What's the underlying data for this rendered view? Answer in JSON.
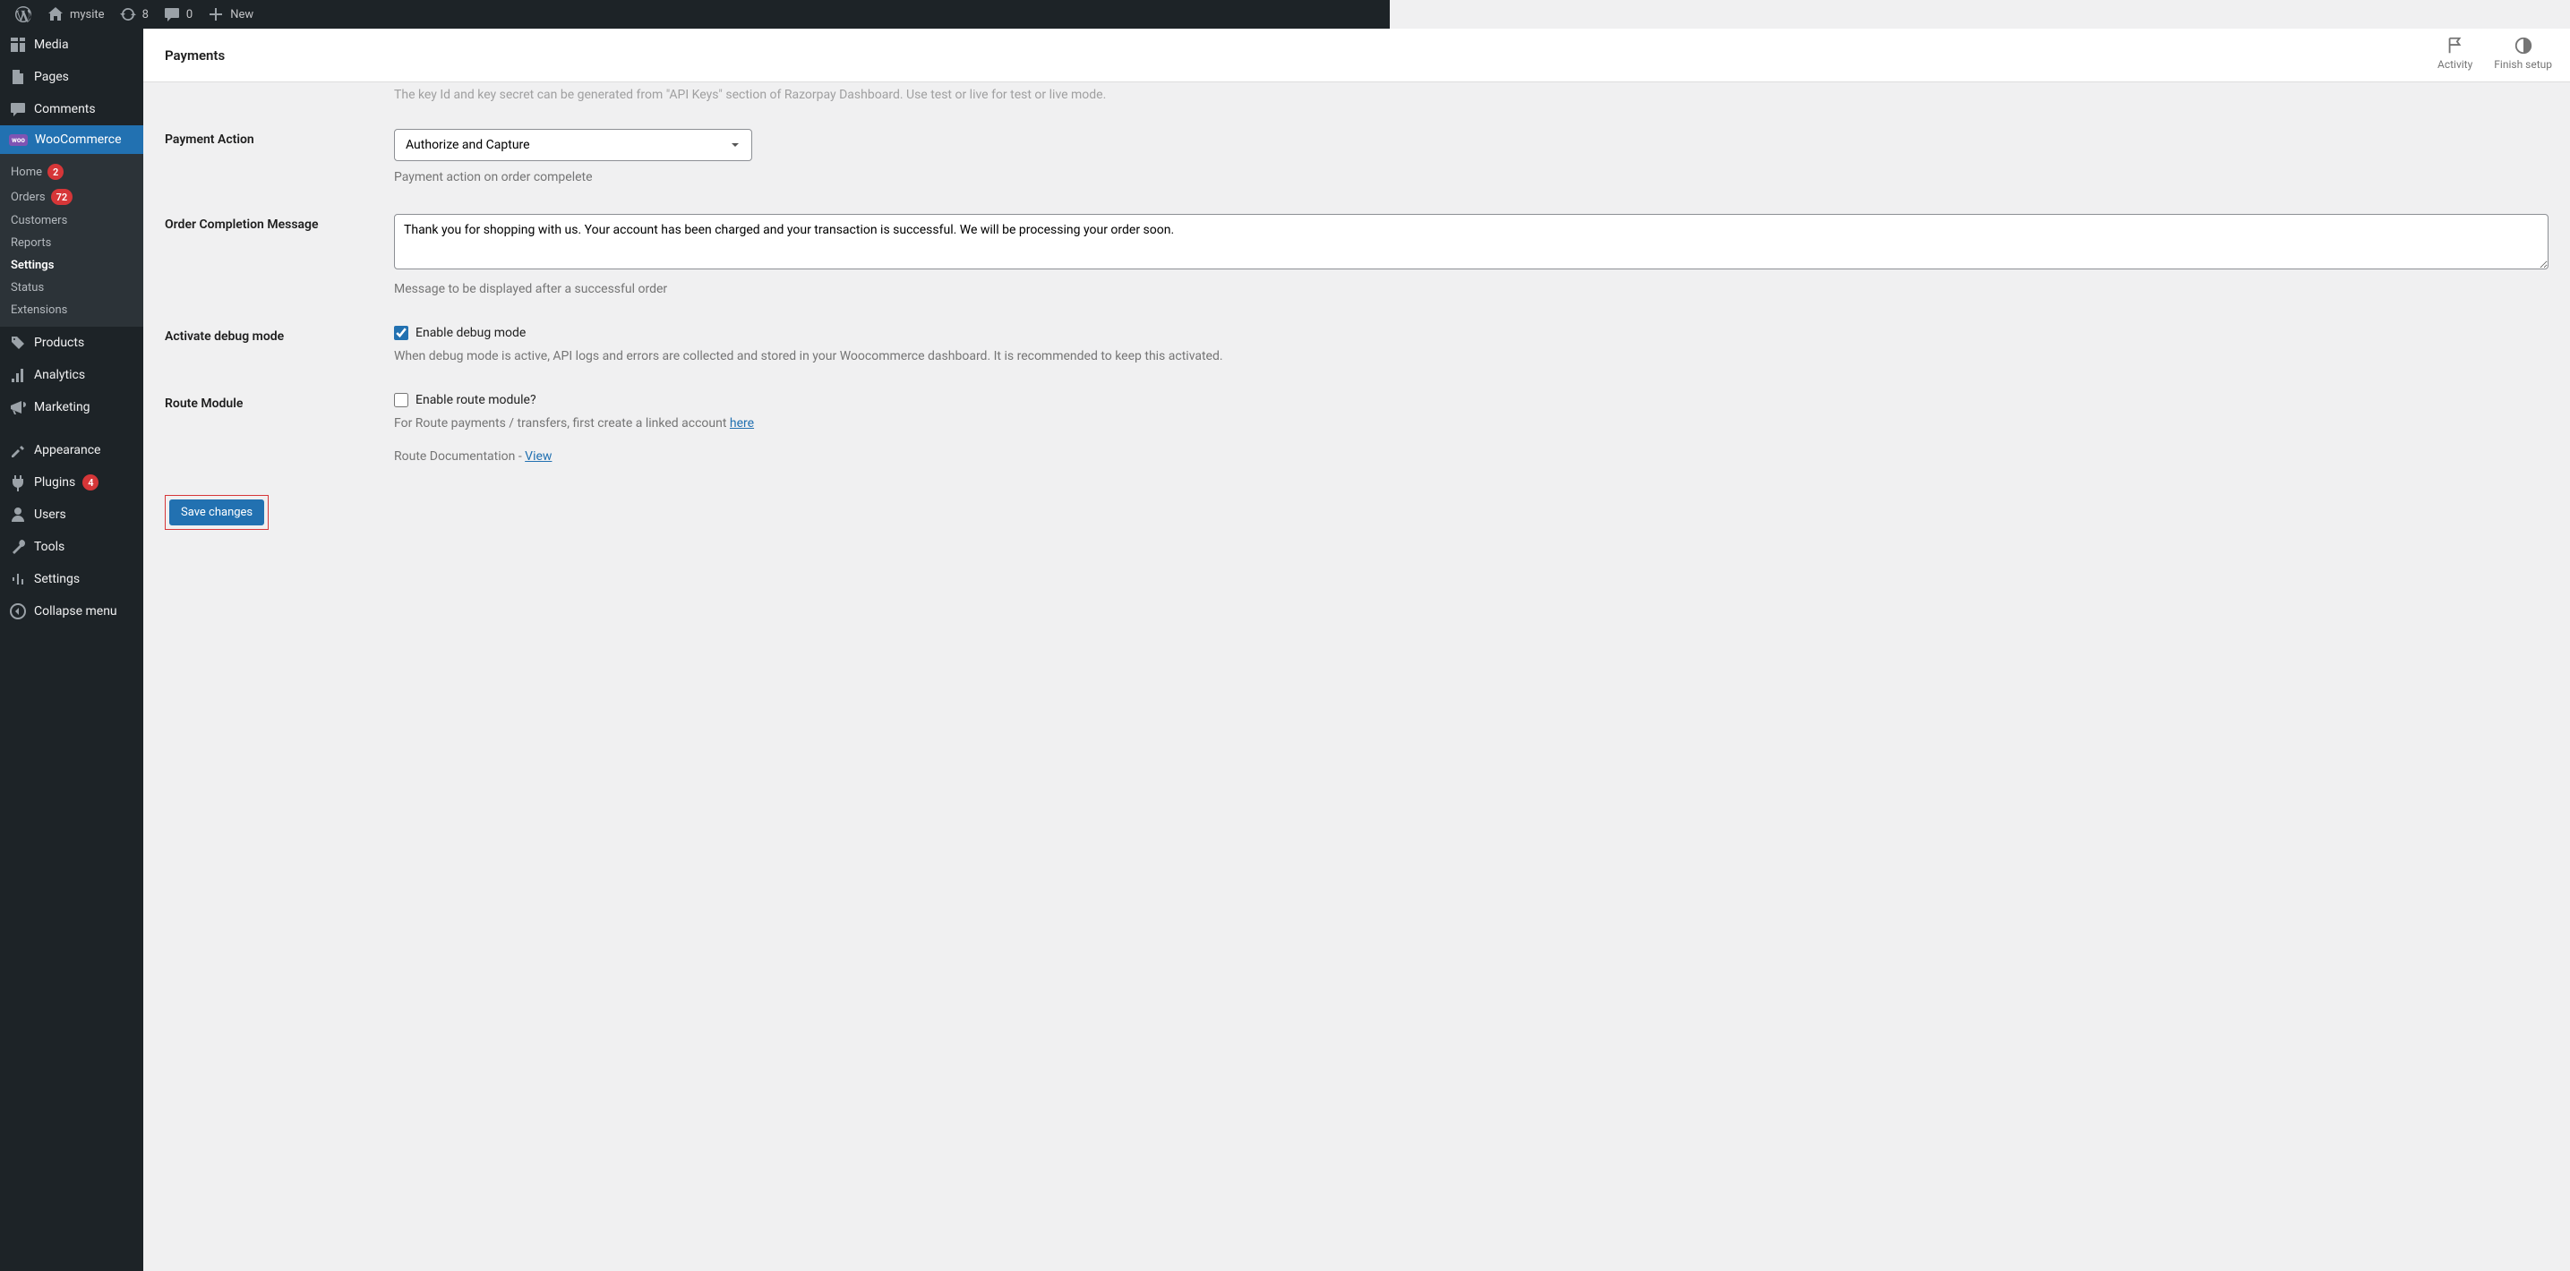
{
  "adminbar": {
    "site_name": "mysite",
    "updates_count": "8",
    "comments_count": "0",
    "new_label": "New"
  },
  "sidebar": {
    "media": "Media",
    "pages": "Pages",
    "comments": "Comments",
    "woocommerce": "WooCommerce",
    "products": "Products",
    "analytics": "Analytics",
    "marketing": "Marketing",
    "appearance": "Appearance",
    "plugins": "Plugins",
    "users": "Users",
    "tools": "Tools",
    "settings": "Settings",
    "collapse": "Collapse menu",
    "woo_sub": {
      "home": "Home",
      "home_badge": "2",
      "orders": "Orders",
      "orders_badge": "72",
      "customers": "Customers",
      "reports": "Reports",
      "settings": "Settings",
      "status": "Status",
      "extensions": "Extensions"
    },
    "plugins_badge": "4"
  },
  "header": {
    "title": "Payments",
    "activity": "Activity",
    "finish_setup": "Finish setup"
  },
  "form": {
    "api_help": "The key Id and key secret can be generated from \"API Keys\" section of Razorpay Dashboard. Use test or live for test or live mode.",
    "payment_action": {
      "label": "Payment Action",
      "value": "Authorize and Capture",
      "help": "Payment action on order compelete"
    },
    "completion_msg": {
      "label": "Order Completion Message",
      "value": "Thank you for shopping with us. Your account has been charged and your transaction is successful. We will be processing your order soon.",
      "help": "Message to be displayed after a successful order"
    },
    "debug": {
      "label": "Activate debug mode",
      "checkbox_label": "Enable debug mode",
      "help": "When debug mode is active, API logs and errors are collected and stored in your Woocommerce dashboard. It is recommended to keep this activated."
    },
    "route": {
      "label": "Route Module",
      "checkbox_label": "Enable route module?",
      "help_prefix": "For Route payments / transfers, first create a linked account ",
      "help_link": "here",
      "doc_prefix": "Route Documentation - ",
      "doc_link": "View"
    },
    "save_button": "Save changes"
  }
}
